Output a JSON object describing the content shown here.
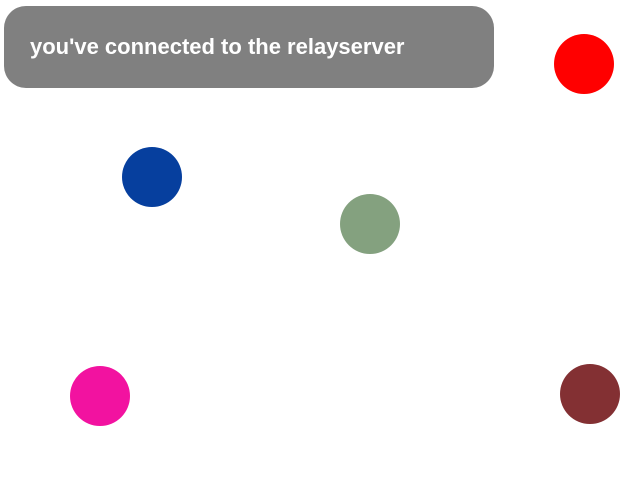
{
  "status": {
    "message": "you've connected to the relayserver"
  },
  "dots": [
    {
      "name": "red",
      "color": "#ff0000"
    },
    {
      "name": "blue",
      "color": "#063f9e"
    },
    {
      "name": "green",
      "color": "#84a17f"
    },
    {
      "name": "pink",
      "color": "#f212a0"
    },
    {
      "name": "maroon",
      "color": "#833033"
    }
  ]
}
